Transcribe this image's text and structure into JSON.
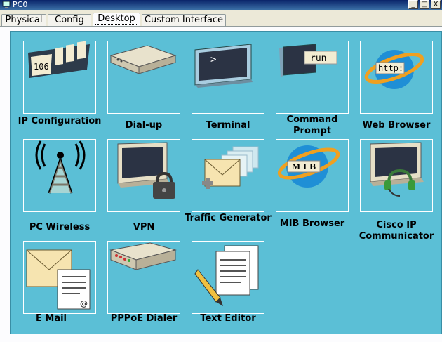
{
  "window": {
    "title": "PC0",
    "min": "_",
    "max": "□",
    "close": "X"
  },
  "tabs": [
    {
      "label": "Physical"
    },
    {
      "label": "Config"
    },
    {
      "label": "Desktop"
    },
    {
      "label": "Custom Interface"
    }
  ],
  "apps": [
    {
      "label": "IP Configuration",
      "icon": "ip-configuration-icon",
      "badge": "106"
    },
    {
      "label": "Dial-up",
      "icon": "modem-icon"
    },
    {
      "label": "Terminal",
      "icon": "terminal-icon",
      "prompt": ">"
    },
    {
      "label": "Command Prompt",
      "icon": "command-prompt-icon",
      "badge": "run"
    },
    {
      "label": "Web Browser",
      "icon": "web-browser-icon",
      "badge": "http:"
    },
    {
      "label": "PC Wireless",
      "icon": "wireless-antenna-icon"
    },
    {
      "label": "VPN",
      "icon": "vpn-lock-icon"
    },
    {
      "label": "Traffic Generator",
      "icon": "traffic-generator-icon"
    },
    {
      "label": "MIB Browser",
      "icon": "mib-browser-icon",
      "badge": "M I B"
    },
    {
      "label": "Cisco IP Communicator",
      "icon": "ip-communicator-icon"
    },
    {
      "label": "E Mail",
      "icon": "email-icon",
      "badge": "@"
    },
    {
      "label": "PPPoE Dialer",
      "icon": "pppoe-dialer-icon"
    },
    {
      "label": "Text Editor",
      "icon": "text-editor-icon"
    }
  ],
  "colors": {
    "panel": "#5bbfd6",
    "titlebar": "#0a246a"
  }
}
